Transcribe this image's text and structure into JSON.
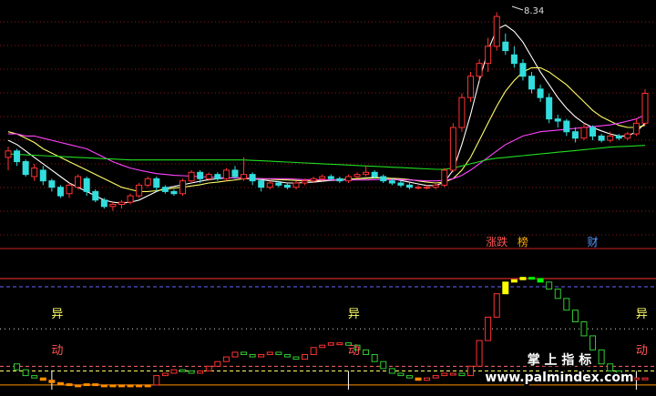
{
  "chart_data": {
    "type": "candlestick",
    "price_panel": {
      "ylim": [
        3.1,
        8.6
      ],
      "peak_label": "8.34",
      "candles": [
        [
          5.0,
          5.25,
          4.7,
          5.15
        ],
        [
          5.15,
          5.2,
          4.8,
          4.9
        ],
        [
          4.9,
          4.95,
          4.55,
          4.6
        ],
        [
          4.55,
          4.85,
          4.45,
          4.75
        ],
        [
          4.7,
          4.8,
          4.35,
          4.45
        ],
        [
          4.45,
          4.5,
          4.2,
          4.3
        ],
        [
          4.3,
          4.35,
          4.05,
          4.1
        ],
        [
          4.15,
          4.4,
          4.05,
          4.35
        ],
        [
          4.3,
          4.6,
          4.25,
          4.55
        ],
        [
          4.5,
          4.55,
          4.1,
          4.2
        ],
        [
          4.2,
          4.25,
          3.95,
          4.0
        ],
        [
          4.0,
          4.05,
          3.8,
          3.85
        ],
        [
          3.85,
          3.95,
          3.75,
          3.9
        ],
        [
          3.9,
          4.0,
          3.8,
          3.95
        ],
        [
          3.95,
          4.15,
          3.9,
          4.1
        ],
        [
          4.1,
          4.4,
          4.05,
          4.35
        ],
        [
          4.35,
          4.55,
          4.3,
          4.5
        ],
        [
          4.5,
          4.55,
          4.2,
          4.3
        ],
        [
          4.3,
          4.35,
          4.15,
          4.2
        ],
        [
          4.2,
          4.25,
          4.1,
          4.15
        ],
        [
          4.15,
          4.5,
          4.1,
          4.45
        ],
        [
          4.45,
          4.7,
          4.4,
          4.65
        ],
        [
          4.65,
          4.7,
          4.4,
          4.5
        ],
        [
          4.5,
          4.65,
          4.45,
          4.6
        ],
        [
          4.6,
          4.65,
          4.45,
          4.5
        ],
        [
          4.5,
          4.75,
          4.45,
          4.7
        ],
        [
          4.7,
          4.8,
          4.5,
          4.55
        ],
        [
          4.5,
          5.0,
          4.45,
          4.6
        ],
        [
          4.6,
          4.65,
          4.35,
          4.45
        ],
        [
          4.45,
          4.5,
          4.2,
          4.3
        ],
        [
          4.3,
          4.45,
          4.25,
          4.4
        ],
        [
          4.4,
          4.45,
          4.3,
          4.35
        ],
        [
          4.35,
          4.4,
          4.25,
          4.3
        ],
        [
          4.3,
          4.45,
          4.25,
          4.4
        ],
        [
          4.4,
          4.5,
          4.35,
          4.45
        ],
        [
          4.45,
          4.55,
          4.4,
          4.5
        ],
        [
          4.5,
          4.6,
          4.45,
          4.55
        ],
        [
          4.55,
          4.6,
          4.45,
          4.5
        ],
        [
          4.5,
          4.55,
          4.4,
          4.45
        ],
        [
          4.45,
          4.6,
          4.4,
          4.55
        ],
        [
          4.55,
          4.65,
          4.5,
          4.6
        ],
        [
          4.6,
          4.8,
          4.55,
          4.65
        ],
        [
          4.65,
          4.7,
          4.5,
          4.55
        ],
        [
          4.55,
          4.6,
          4.4,
          4.45
        ],
        [
          4.45,
          4.5,
          4.35,
          4.4
        ],
        [
          4.4,
          4.45,
          4.3,
          4.35
        ],
        [
          4.35,
          4.4,
          4.25,
          4.3
        ],
        [
          4.3,
          4.35,
          4.25,
          4.3
        ],
        [
          4.3,
          4.35,
          4.25,
          4.3
        ],
        [
          4.3,
          4.4,
          4.25,
          4.35
        ],
        [
          4.35,
          4.75,
          4.3,
          4.7
        ],
        [
          4.7,
          5.8,
          4.65,
          5.7
        ],
        [
          5.7,
          6.5,
          5.6,
          6.4
        ],
        [
          6.4,
          7.0,
          6.3,
          6.9
        ],
        [
          6.9,
          7.3,
          6.8,
          7.2
        ],
        [
          7.2,
          7.8,
          7.0,
          7.6
        ],
        [
          7.6,
          8.4,
          7.5,
          8.3
        ],
        [
          7.7,
          7.9,
          7.4,
          7.5
        ],
        [
          7.4,
          7.6,
          7.1,
          7.2
        ],
        [
          7.2,
          7.3,
          6.8,
          6.9
        ],
        [
          6.9,
          7.0,
          6.5,
          6.6
        ],
        [
          6.6,
          6.7,
          6.3,
          6.4
        ],
        [
          6.4,
          6.5,
          5.8,
          5.9
        ],
        [
          5.9,
          6.0,
          5.7,
          5.85
        ],
        [
          5.85,
          5.9,
          5.5,
          5.6
        ],
        [
          5.6,
          5.7,
          5.35,
          5.45
        ],
        [
          5.45,
          5.8,
          5.4,
          5.7
        ],
        [
          5.7,
          5.75,
          5.4,
          5.5
        ],
        [
          5.5,
          5.55,
          5.35,
          5.4
        ],
        [
          5.4,
          5.6,
          5.35,
          5.5
        ],
        [
          5.5,
          5.55,
          5.4,
          5.45
        ],
        [
          5.45,
          5.6,
          5.4,
          5.55
        ],
        [
          5.55,
          5.9,
          5.5,
          5.8
        ],
        [
          5.8,
          6.6,
          5.75,
          6.5
        ]
      ],
      "ma_lines": [
        {
          "color": "#ffffff",
          "values": [
            5.4,
            5.3,
            5.15,
            5.0,
            4.85,
            4.7,
            4.55,
            4.4,
            4.3,
            4.2,
            4.1,
            4.0,
            3.95,
            3.93,
            3.95,
            4.0,
            4.1,
            4.2,
            4.28,
            4.32,
            4.36,
            4.4,
            4.44,
            4.48,
            4.5,
            4.52,
            4.52,
            4.52,
            4.5,
            4.48,
            4.45,
            4.43,
            4.4,
            4.4,
            4.41,
            4.42,
            4.44,
            4.46,
            4.47,
            4.48,
            4.5,
            4.52,
            4.53,
            4.52,
            4.5,
            4.46,
            4.42,
            4.38,
            4.34,
            4.34,
            4.42,
            4.7,
            5.3,
            6.0,
            6.8,
            7.5,
            8.0,
            8.1,
            7.95,
            7.7,
            7.35,
            7.0,
            6.7,
            6.4,
            6.15,
            5.95,
            5.8,
            5.7,
            5.62,
            5.55,
            5.5,
            5.5,
            5.6,
            5.8
          ]
        },
        {
          "color": "#ffff66",
          "values": [
            5.6,
            5.55,
            5.45,
            5.35,
            5.2,
            5.1,
            5.0,
            4.9,
            4.8,
            4.7,
            4.6,
            4.5,
            4.4,
            4.3,
            4.25,
            4.2,
            4.2,
            4.22,
            4.25,
            4.28,
            4.3,
            4.33,
            4.36,
            4.4,
            4.42,
            4.45,
            4.47,
            4.5,
            4.5,
            4.5,
            4.49,
            4.48,
            4.47,
            4.46,
            4.45,
            4.45,
            4.46,
            4.47,
            4.48,
            4.49,
            4.5,
            4.51,
            4.52,
            4.52,
            4.51,
            4.5,
            4.48,
            4.45,
            4.42,
            4.4,
            4.42,
            4.5,
            4.7,
            5.0,
            5.4,
            5.8,
            6.2,
            6.55,
            6.8,
            7.0,
            7.1,
            7.1,
            7.0,
            6.85,
            6.7,
            6.5,
            6.3,
            6.1,
            5.95,
            5.85,
            5.75,
            5.7,
            5.7,
            5.75
          ]
        },
        {
          "color": "#ff44ff",
          "values": [
            5.55,
            5.55,
            5.5,
            5.5,
            5.45,
            5.4,
            5.35,
            5.3,
            5.25,
            5.2,
            5.1,
            5.0,
            4.9,
            4.82,
            4.75,
            4.7,
            4.66,
            4.62,
            4.6,
            4.58,
            4.57,
            4.56,
            4.55,
            4.54,
            4.53,
            4.52,
            4.52,
            4.52,
            4.51,
            4.5,
            4.5,
            4.5,
            4.5,
            4.49,
            4.48,
            4.48,
            4.47,
            4.47,
            4.47,
            4.47,
            4.47,
            4.47,
            4.48,
            4.48,
            4.48,
            4.48,
            4.47,
            4.46,
            4.45,
            4.45,
            4.46,
            4.5,
            4.58,
            4.7,
            4.85,
            5.0,
            5.15,
            5.3,
            5.4,
            5.5,
            5.55,
            5.6,
            5.62,
            5.64,
            5.66,
            5.68,
            5.7,
            5.72,
            5.74,
            5.76,
            5.8,
            5.85,
            5.9,
            6.0
          ]
        },
        {
          "color": "#22dd22",
          "values": [
            5.08,
            5.07,
            5.06,
            5.05,
            5.04,
            5.03,
            5.02,
            5.01,
            5.0,
            4.99,
            4.98,
            4.97,
            4.96,
            4.95,
            4.94,
            4.94,
            4.94,
            4.94,
            4.94,
            4.94,
            4.94,
            4.94,
            4.94,
            4.94,
            4.94,
            4.94,
            4.94,
            4.94,
            4.93,
            4.92,
            4.91,
            4.9,
            4.89,
            4.88,
            4.87,
            4.86,
            4.85,
            4.84,
            4.83,
            4.82,
            4.81,
            4.8,
            4.79,
            4.78,
            4.77,
            4.76,
            4.75,
            4.74,
            4.73,
            4.72,
            4.72,
            4.75,
            4.8,
            4.85,
            4.9,
            4.95,
            4.98,
            5.0,
            5.02,
            5.04,
            5.06,
            5.08,
            5.1,
            5.12,
            5.14,
            5.16,
            5.18,
            5.2,
            5.22,
            5.24,
            5.25,
            5.26,
            5.27,
            5.28
          ]
        }
      ],
      "signals": [
        {
          "text": "涨跌",
          "color": "#ff5555",
          "bar": 56
        },
        {
          "text": "榜",
          "color": "#ffaa00",
          "bar": 59
        },
        {
          "text": "财",
          "color": "#5599ff",
          "bar": 67
        }
      ]
    },
    "indicator_panel": {
      "ylim": [
        -2,
        100
      ],
      "values": [
        20,
        15,
        10,
        8,
        6,
        4,
        3,
        2,
        2,
        3,
        2,
        2,
        2,
        2,
        2,
        2,
        2,
        10,
        12,
        15,
        14,
        12,
        14,
        18,
        22,
        26,
        30,
        28,
        26,
        28,
        30,
        28,
        26,
        24,
        28,
        34,
        36,
        38,
        38,
        36,
        32,
        28,
        22,
        16,
        12,
        10,
        8,
        6,
        8,
        10,
        12,
        12,
        10,
        18,
        40,
        60,
        80,
        90,
        92,
        94,
        93,
        90,
        84,
        76,
        66,
        56,
        44,
        32,
        20,
        14,
        10,
        8,
        8,
        8
      ],
      "ref_lines": [
        {
          "value": 93,
          "color": "#ff3333",
          "style": "solid"
        },
        {
          "value": 86,
          "color": "#6666ff",
          "style": "dashed"
        },
        {
          "value": 50,
          "color": "#dddddd",
          "style": "dotted"
        },
        {
          "value": 18,
          "color": "#ff6666",
          "style": "dashed"
        },
        {
          "value": 14,
          "color": "#ffff66",
          "style": "dashed"
        },
        {
          "value": 2,
          "color": "#ff8c00",
          "style": "solid"
        }
      ],
      "markers": [
        {
          "text": "异",
          "color": "#ffff66",
          "bar": 5
        },
        {
          "text": "动",
          "color": "#ff5555",
          "bar": 5
        },
        {
          "text": "异",
          "color": "#ffff66",
          "bar": 39
        },
        {
          "text": "动",
          "color": "#ff5555",
          "bar": 39
        },
        {
          "text": "异",
          "color": "#ffff66",
          "bar": 72
        },
        {
          "text": "动",
          "color": "#ff5555",
          "bar": 72
        }
      ]
    }
  },
  "watermark": {
    "line1": "掌 上 指 标",
    "line2": "www.palmindex.com"
  }
}
